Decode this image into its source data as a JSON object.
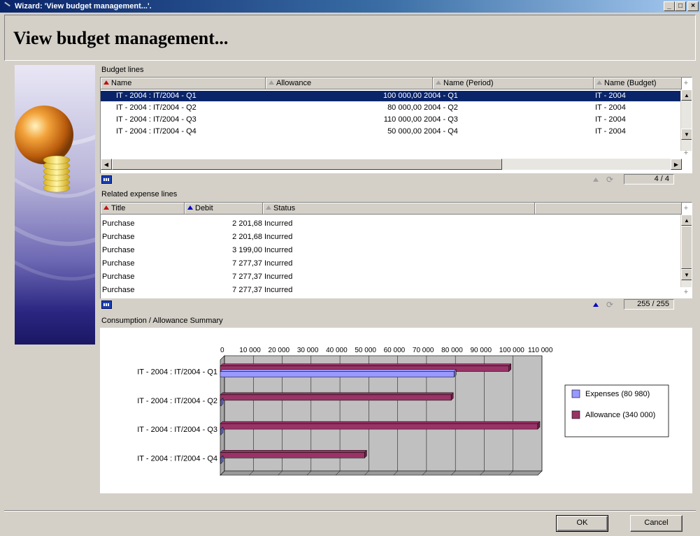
{
  "window": {
    "title": "Wizard: 'View budget management...'.",
    "minimize": "_",
    "maximize": "□",
    "close": "×"
  },
  "page": {
    "heading": "View budget management..."
  },
  "budget_lines": {
    "label": "Budget lines",
    "columns": [
      "Name",
      "Allowance",
      "Name (Period)",
      "Name (Budget)"
    ],
    "rows": [
      {
        "name": "IT - 2004 : IT/2004 - Q1",
        "allowance": "100 000,00",
        "period": "2004 - Q1",
        "budget": "IT - 2004",
        "selected": true
      },
      {
        "name": "IT - 2004 : IT/2004 - Q2",
        "allowance": "80 000,00",
        "period": "2004 - Q2",
        "budget": "IT - 2004",
        "selected": false
      },
      {
        "name": "IT - 2004 : IT/2004 - Q3",
        "allowance": "110 000,00",
        "period": "2004 - Q3",
        "budget": "IT - 2004",
        "selected": false
      },
      {
        "name": "IT - 2004 : IT/2004 - Q4",
        "allowance": "50 000,00",
        "period": "2004 - Q4",
        "budget": "IT - 2004",
        "selected": false
      }
    ],
    "counter": "4 / 4"
  },
  "expense_lines": {
    "label": "Related expense lines",
    "columns": [
      "Title",
      "Debit",
      "Status"
    ],
    "rows": [
      {
        "title": "Purchase",
        "debit": "2 201,68",
        "status": "Incurred"
      },
      {
        "title": "Purchase",
        "debit": "2 201,68",
        "status": "Incurred"
      },
      {
        "title": "Purchase",
        "debit": "3 199,00",
        "status": "Incurred"
      },
      {
        "title": "Purchase",
        "debit": "7 277,37",
        "status": "Incurred"
      },
      {
        "title": "Purchase",
        "debit": "7 277,37",
        "status": "Incurred"
      },
      {
        "title": "Purchase",
        "debit": "7 277,37",
        "status": "Incurred"
      }
    ],
    "counter": "255 / 255"
  },
  "summary": {
    "label": "Consumption / Allowance Summary"
  },
  "chart_data": {
    "type": "bar",
    "orientation": "horizontal",
    "style": "3d",
    "categories": [
      "IT - 2004 : IT/2004 - Q1",
      "IT - 2004 : IT/2004 - Q2",
      "IT - 2004 : IT/2004 - Q3",
      "IT - 2004 : IT/2004 - Q4"
    ],
    "series": [
      {
        "name": "Expenses (80 980)",
        "color": "#9999ff",
        "values": [
          80980,
          0,
          0,
          0
        ]
      },
      {
        "name": "Allowance (340 000)",
        "color": "#993366",
        "values": [
          100000,
          80000,
          110000,
          50000
        ]
      }
    ],
    "x_ticks": [
      "0",
      "10 000",
      "20 000",
      "30 000",
      "40 000",
      "50 000",
      "60 000",
      "70 000",
      "80 000",
      "90 000",
      "100 000",
      "110 000"
    ],
    "xlim": [
      0,
      110000
    ],
    "grid": true,
    "legend": "right"
  },
  "buttons": {
    "ok": "OK",
    "cancel": "Cancel"
  },
  "colors": {
    "selection": "#0a246a",
    "titlebar": "#0a246a",
    "face": "#d4d0c8"
  }
}
